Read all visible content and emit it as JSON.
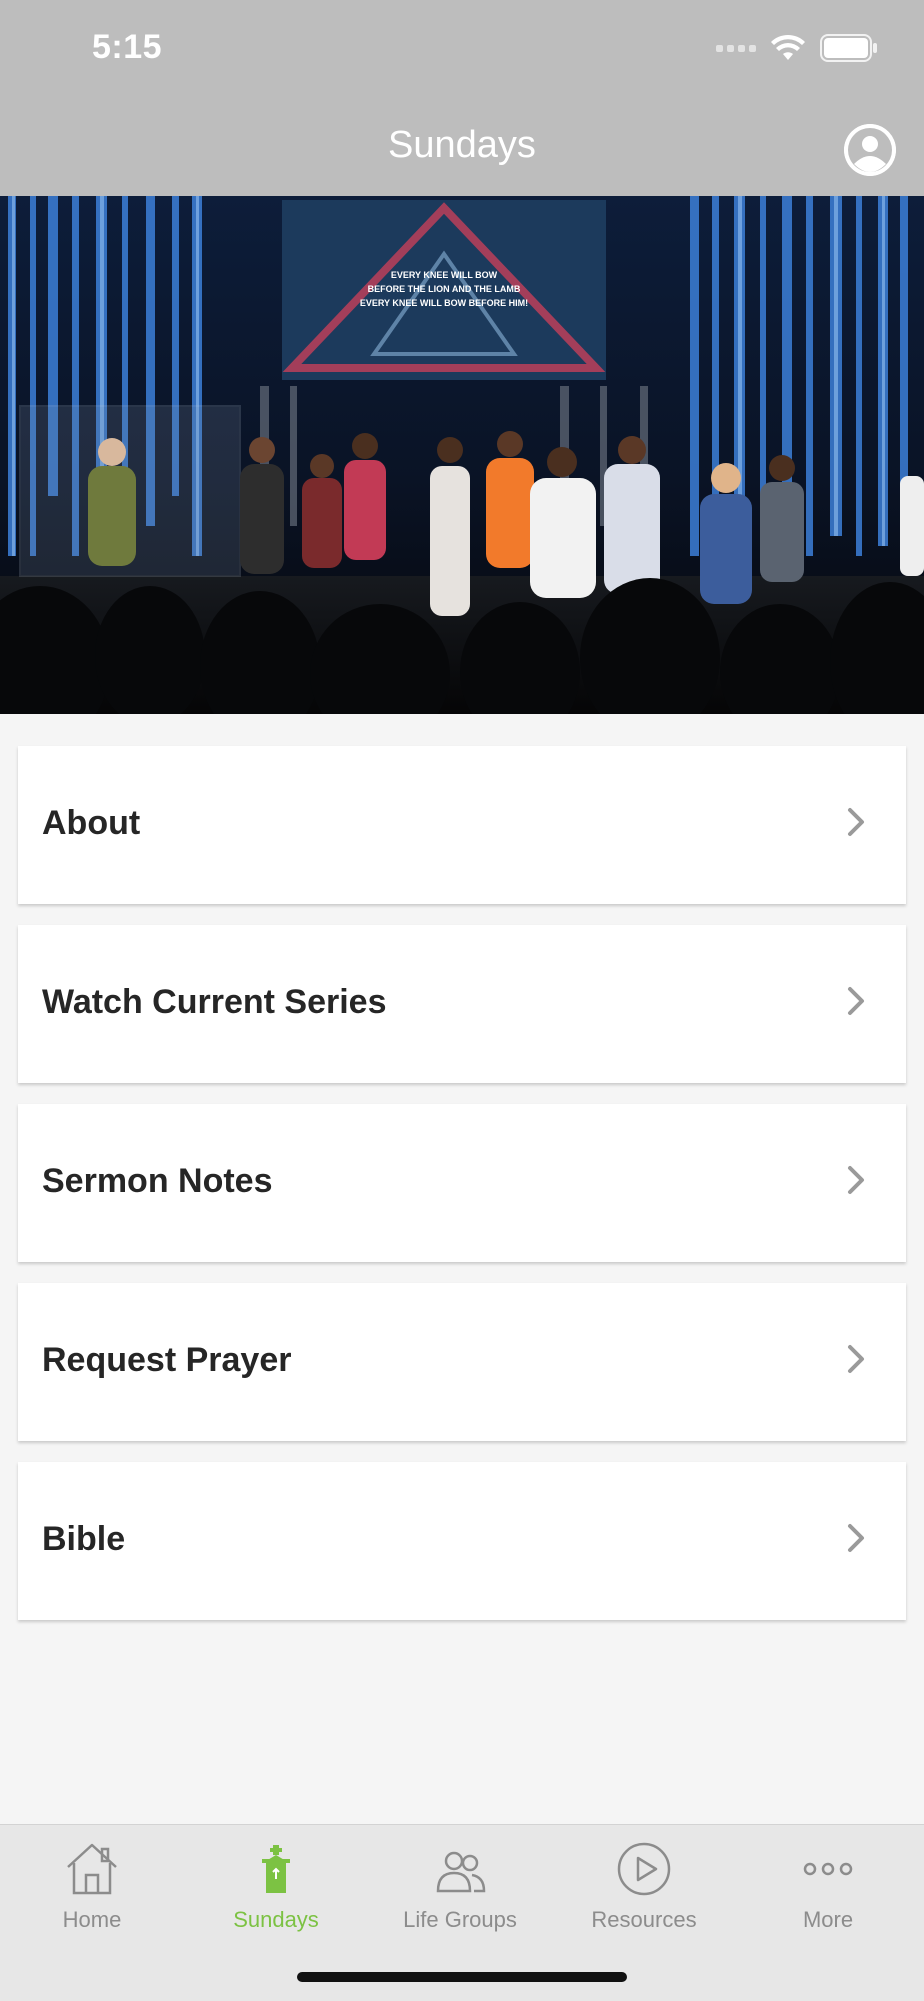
{
  "status_bar": {
    "time": "5:15"
  },
  "header": {
    "title": "Sundays"
  },
  "hero": {
    "screen_text": [
      "EVERY KNEE WILL BOW",
      "BEFORE THE LION AND THE LAMB",
      "EVERY KNEE WILL BOW BEFORE HIM!"
    ]
  },
  "menu": [
    {
      "label": "About"
    },
    {
      "label": "Watch Current Series"
    },
    {
      "label": "Sermon Notes"
    },
    {
      "label": "Request Prayer"
    },
    {
      "label": "Bible"
    }
  ],
  "tabs": [
    {
      "label": "Home",
      "icon": "house-icon",
      "active": false
    },
    {
      "label": "Sundays",
      "icon": "church-icon",
      "active": true
    },
    {
      "label": "Life Groups",
      "icon": "people-icon",
      "active": false
    },
    {
      "label": "Resources",
      "icon": "play-circle-icon",
      "active": false
    },
    {
      "label": "More",
      "icon": "dots-icon",
      "active": false
    }
  ],
  "colors": {
    "header_bg": "#bdbdbd",
    "accent": "#7cc243",
    "tab_inactive": "#8c8c8c",
    "page_bg": "#f5f5f5"
  }
}
